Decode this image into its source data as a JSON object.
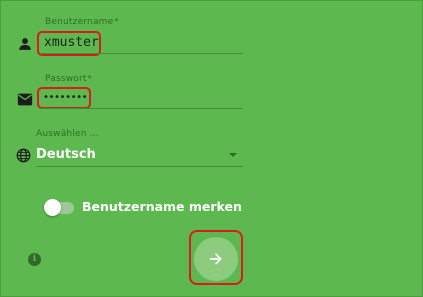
{
  "login": {
    "username": {
      "label": "Benutzername",
      "required_mark": "*",
      "value": "xmuster",
      "icon": "person-icon"
    },
    "password": {
      "label": "Passwort",
      "required_mark": "*",
      "value": "••••••••",
      "icon": "envelope-icon"
    },
    "language": {
      "label": "Auswählen ...",
      "selected": "Deutsch",
      "icon": "globe-icon"
    },
    "remember": {
      "label": "Benutzername merken",
      "checked": false
    },
    "submit": {
      "icon": "arrow-right-icon"
    },
    "info_icon_glyph": "i"
  },
  "colors": {
    "background": "#5db84f",
    "highlight": "#d91c1c",
    "submit_button": "#8dcb7f",
    "text_dark": "#1f1f1f",
    "text_light": "#ffffff"
  }
}
